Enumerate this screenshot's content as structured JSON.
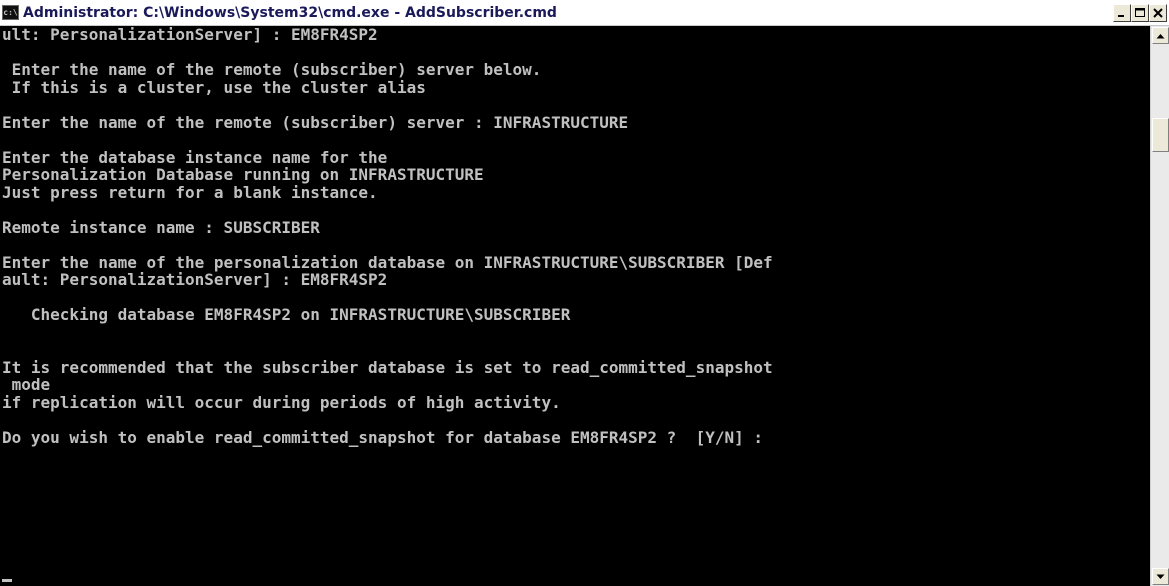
{
  "window": {
    "title": "Administrator: C:\\Windows\\System32\\cmd.exe - AddSubscriber.cmd",
    "icon_label": "c:\\",
    "icon": "cmd-icon",
    "caption_buttons": [
      "minimize-icon",
      "maximize-icon",
      "close-icon"
    ]
  },
  "console": {
    "background": "#000000",
    "foreground": "#c0c0c0",
    "lines": [
      "ult: PersonalizationServer] : EM8FR4SP2",
      "",
      " Enter the name of the remote (subscriber) server below.",
      " If this is a cluster, use the cluster alias",
      "",
      "Enter the name of the remote (subscriber) server : INFRASTRUCTURE",
      "",
      "Enter the database instance name for the",
      "Personalization Database running on INFRASTRUCTURE",
      "Just press return for a blank instance.",
      "",
      "Remote instance name : SUBSCRIBER",
      "",
      "Enter the name of the personalization database on INFRASTRUCTURE\\SUBSCRIBER [Def",
      "ault: PersonalizationServer] : EM8FR4SP2",
      "",
      "   Checking database EM8FR4SP2 on INFRASTRUCTURE\\SUBSCRIBER",
      "",
      "",
      "It is recommended that the subscriber database is set to read_committed_snapshot",
      " mode",
      "if replication will occur during periods of high activity.",
      "",
      "Do you wish to enable read_committed_snapshot for database EM8FR4SP2 ?  [Y/N] :",
      ""
    ]
  },
  "scrollbar": {
    "up_icon": "arrow-up-icon",
    "down_icon": "arrow-down-icon",
    "position": 0.15
  }
}
